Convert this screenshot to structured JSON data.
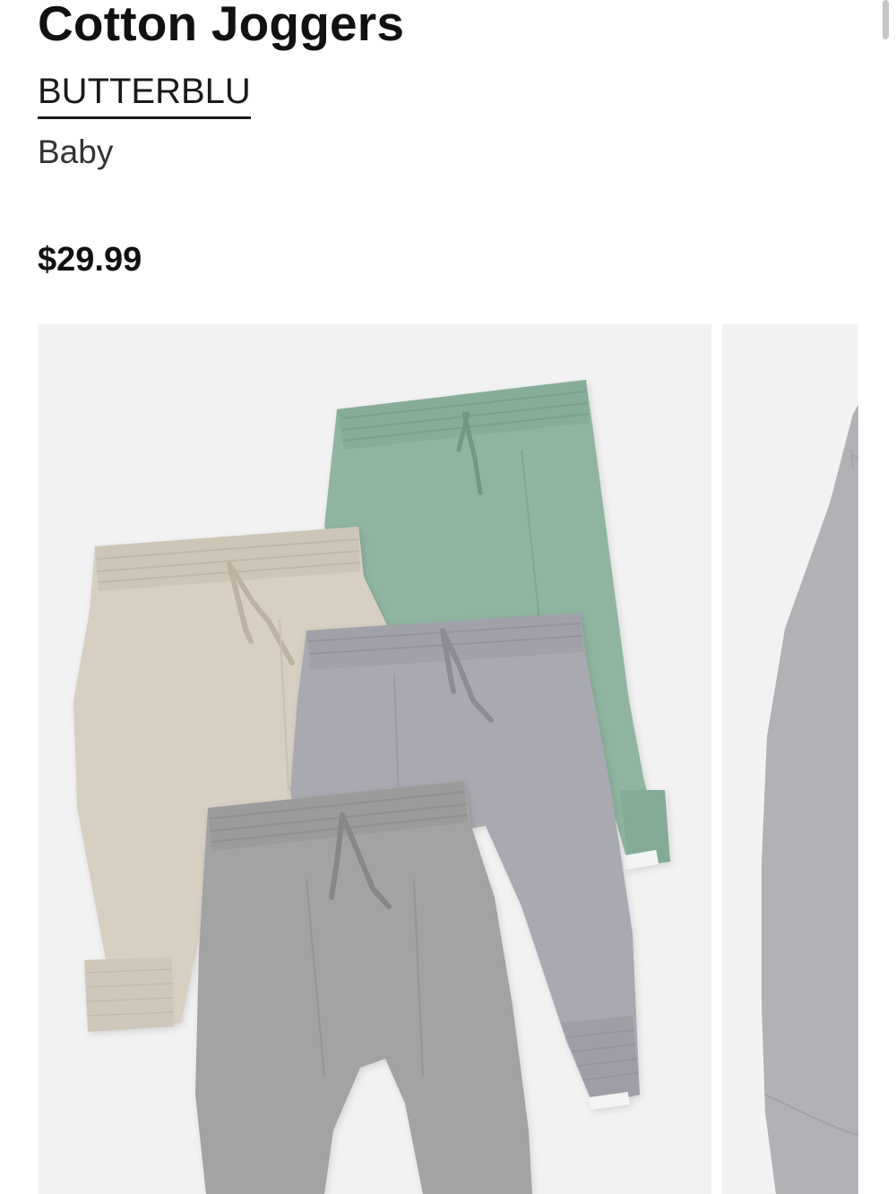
{
  "product": {
    "title": "Cotton Joggers",
    "brand": "BUTTERBLU",
    "category": "Baby",
    "price": "$29.99"
  },
  "gallery": {
    "images": [
      {
        "name": "product-image-joggers-4-pack",
        "colors": [
          "#d6cfc2",
          "#8fb5a0",
          "#a9a9b1",
          "#a3a3a3"
        ]
      },
      {
        "name": "product-image-next-partial",
        "colors": [
          "#b2b2b6"
        ]
      }
    ],
    "tag_text": "butterblu"
  },
  "colors": {
    "background": "#ffffff",
    "image_background": "#f2f2f2",
    "text": "#111111"
  }
}
